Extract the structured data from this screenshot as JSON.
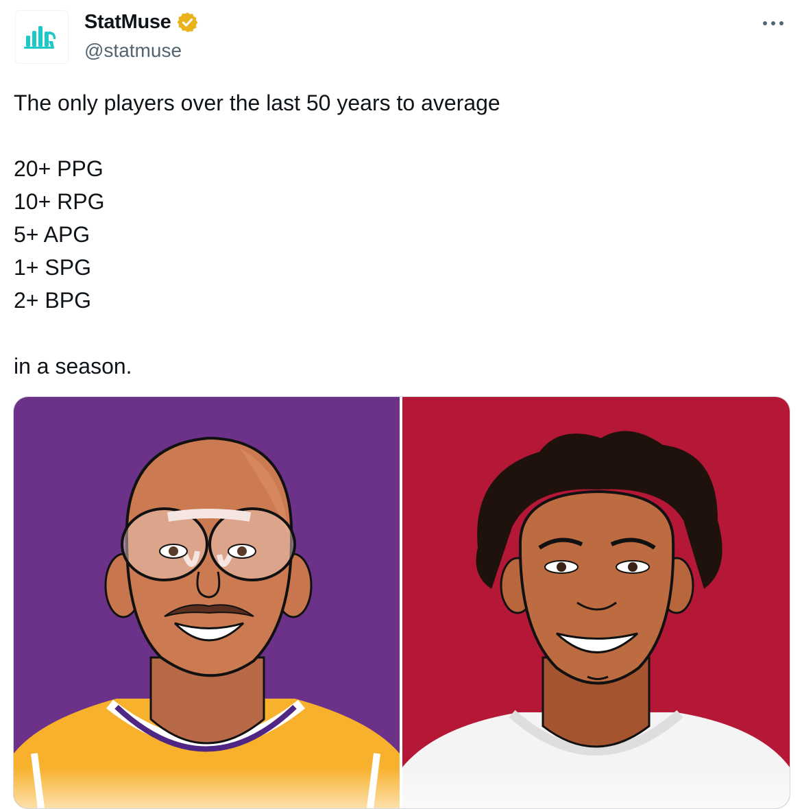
{
  "author": {
    "display_name": "StatMuse",
    "handle": "@statmuse",
    "verified": true,
    "avatar_icon": "statmuse-logo-icon",
    "avatar_color": "#1ec8c8",
    "badge_color": "#e8b31c"
  },
  "tweet": {
    "text": "The only players over the last 50 years to average\n\n20+ PPG\n10+ RPG\n5+ APG\n1+ SPG\n2+ BPG\n\nin a season."
  },
  "more_icon": "more-options-icon",
  "media": {
    "images": [
      {
        "bg_color": "#6c3189",
        "jersey_color": "#f7b12c",
        "trim_color": "#4f2683"
      },
      {
        "bg_color": "#b51737",
        "jersey_color": "#f4f4f4",
        "trim_color": "#dedede"
      }
    ]
  }
}
